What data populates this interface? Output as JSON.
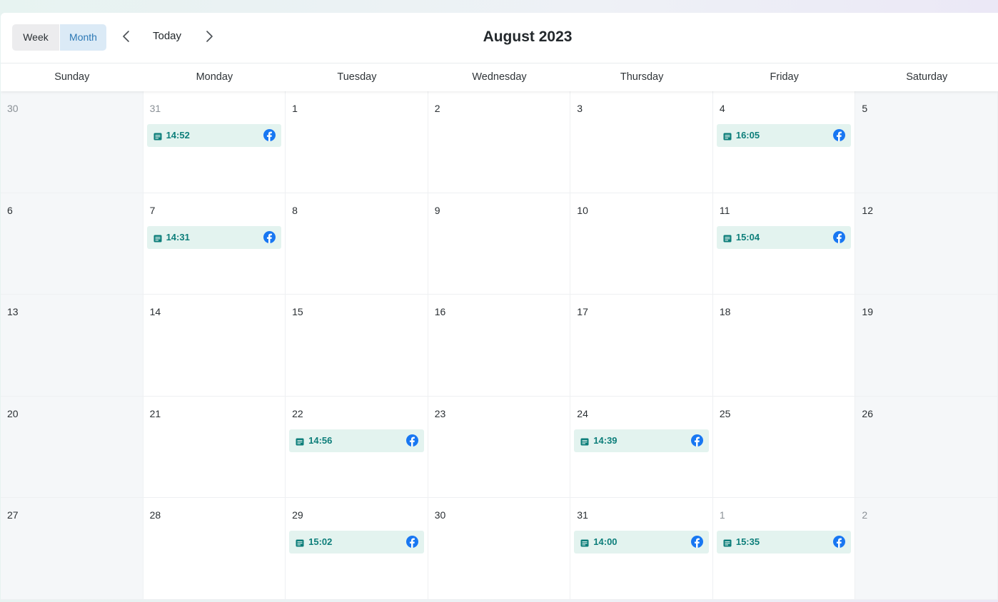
{
  "toolbar": {
    "view_week": "Week",
    "view_month": "Month",
    "today": "Today",
    "title": "August 2023",
    "active_view": "Month",
    "prev_icon": "chevron-left-icon",
    "next_icon": "chevron-right-icon"
  },
  "weekdays": [
    "Sunday",
    "Monday",
    "Tuesday",
    "Wednesday",
    "Thursday",
    "Friday",
    "Saturday"
  ],
  "colors": {
    "event_bg": "#e3f3ef",
    "event_text": "#0d7e7a",
    "facebook": "#1877f2",
    "active_view_bg": "#dbeaf6",
    "active_view_text": "#2c78b5"
  },
  "weeks": [
    [
      {
        "day": "30",
        "other_month": true,
        "weekend": true
      },
      {
        "day": "31",
        "other_month": true,
        "events": [
          {
            "time": "14:52",
            "icon": "document-icon",
            "network": "facebook-icon"
          }
        ]
      },
      {
        "day": "1"
      },
      {
        "day": "2"
      },
      {
        "day": "3"
      },
      {
        "day": "4",
        "events": [
          {
            "time": "16:05",
            "icon": "document-icon",
            "network": "facebook-icon"
          }
        ]
      },
      {
        "day": "5",
        "weekend": true
      }
    ],
    [
      {
        "day": "6",
        "weekend": true
      },
      {
        "day": "7",
        "events": [
          {
            "time": "14:31",
            "icon": "document-icon",
            "network": "facebook-icon"
          }
        ]
      },
      {
        "day": "8"
      },
      {
        "day": "9"
      },
      {
        "day": "10"
      },
      {
        "day": "11",
        "events": [
          {
            "time": "15:04",
            "icon": "document-icon",
            "network": "facebook-icon"
          }
        ]
      },
      {
        "day": "12",
        "weekend": true
      }
    ],
    [
      {
        "day": "13",
        "weekend": true
      },
      {
        "day": "14"
      },
      {
        "day": "15"
      },
      {
        "day": "16"
      },
      {
        "day": "17"
      },
      {
        "day": "18"
      },
      {
        "day": "19",
        "weekend": true
      }
    ],
    [
      {
        "day": "20",
        "weekend": true
      },
      {
        "day": "21"
      },
      {
        "day": "22",
        "events": [
          {
            "time": "14:56",
            "icon": "document-icon",
            "network": "facebook-icon"
          }
        ]
      },
      {
        "day": "23"
      },
      {
        "day": "24",
        "events": [
          {
            "time": "14:39",
            "icon": "document-icon",
            "network": "facebook-icon"
          }
        ]
      },
      {
        "day": "25"
      },
      {
        "day": "26",
        "weekend": true
      }
    ],
    [
      {
        "day": "27",
        "weekend": true
      },
      {
        "day": "28"
      },
      {
        "day": "29",
        "events": [
          {
            "time": "15:02",
            "icon": "document-icon",
            "network": "facebook-icon"
          }
        ]
      },
      {
        "day": "30"
      },
      {
        "day": "31",
        "events": [
          {
            "time": "14:00",
            "icon": "document-icon",
            "network": "facebook-icon"
          }
        ]
      },
      {
        "day": "1",
        "other_month": true,
        "events": [
          {
            "time": "15:35",
            "icon": "document-icon",
            "network": "facebook-icon"
          }
        ]
      },
      {
        "day": "2",
        "other_month": true,
        "weekend": true
      }
    ]
  ]
}
